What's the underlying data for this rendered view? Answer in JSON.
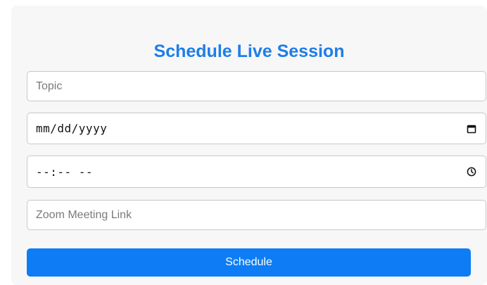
{
  "form": {
    "title": "Schedule Live Session",
    "topic": {
      "value": "",
      "placeholder": "Topic"
    },
    "date": {
      "display": "mm/dd/yyyy",
      "icon": "calendar-icon"
    },
    "time": {
      "display": "--:-- --",
      "icon": "clock-icon"
    },
    "zoom_link": {
      "value": "",
      "placeholder": "Zoom Meeting Link"
    },
    "submit_label": "Schedule"
  },
  "colors": {
    "accent": "#1e7ee8",
    "button": "#0d7cf5",
    "card_background": "#f7f7f8",
    "border": "#c8c8c8"
  }
}
